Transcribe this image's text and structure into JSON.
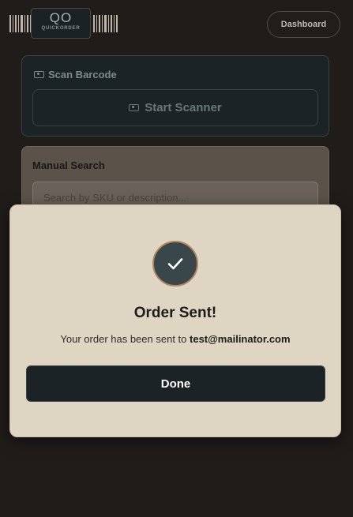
{
  "header": {
    "logo_main": "QO",
    "logo_sub": "QUICKORDER",
    "dashboard_label": "Dashboard"
  },
  "scan_card": {
    "title": "Scan Barcode",
    "start_label": "Start Scanner"
  },
  "search_card": {
    "title": "Manual Search",
    "placeholder": "Search by SKU or description..."
  },
  "modal": {
    "title": "Order Sent!",
    "message_prefix": "Your order has been sent to ",
    "email": "test@mailinator.com",
    "done_label": "Done"
  },
  "colors": {
    "background": "#1f1c1a",
    "modal_bg": "#ded5c2",
    "dark_button": "#1b2327",
    "accent_ring": "#b08660"
  }
}
